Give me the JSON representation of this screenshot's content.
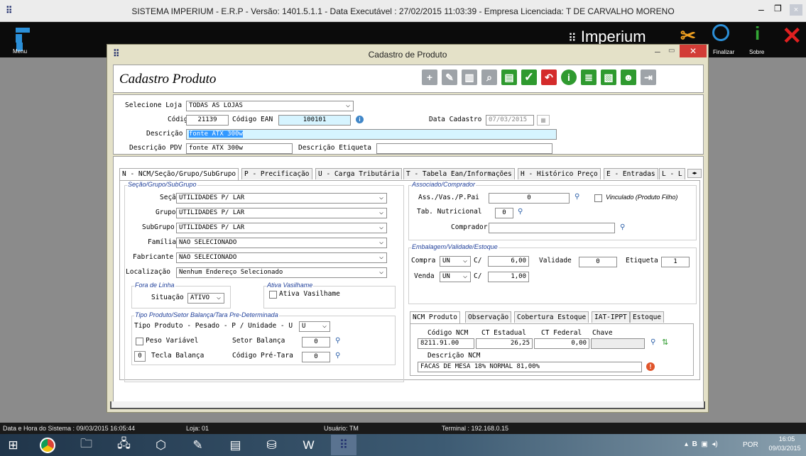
{
  "titlebar": {
    "title": "SISTEMA IMPERIUM - E.R.P - Versão: 1401.5.1.1 - Data Executável : 27/02/2015 11:03:39 - Empresa Licenciada: T DE CARVALHO MORENO"
  },
  "topband": {
    "menu_label": "Menu",
    "brand": "Imperium",
    "finalizar_label": "Finalizar",
    "sobre_label": "Sobre"
  },
  "window": {
    "title": "Cadastro de Produto",
    "heading": "Cadastro Produto"
  },
  "toolbar": {
    "icons": [
      "plus-icon",
      "edit-icon",
      "delete-icon",
      "search-icon",
      "document-icon",
      "confirm-icon",
      "undo-icon",
      "info-icon",
      "report-search-icon",
      "report-icon",
      "user-icon",
      "exit-icon"
    ],
    "colors": {
      "confirm": "#2f9a2f",
      "undo": "#d42b2b",
      "neutral": "#9ea3a8"
    }
  },
  "header": {
    "loja_label": "Selecione Loja",
    "loja_value": "TODAS AS LOJAS",
    "codigo_label": "Código",
    "codigo_value": "21139",
    "ean_label": "Código EAN",
    "ean_value": "100101",
    "data_label": "Data Cadastro",
    "data_value": "07/03/2015",
    "descricao_label": "Descrição",
    "descricao_value": "fonte ATX 300w",
    "pdv_label": "Descrição PDV",
    "pdv_value": "fonte ATX 300w",
    "etiqueta_label": "Descrição Etiqueta",
    "etiqueta_value": ""
  },
  "tabs": [
    "N - NCM/Seção/Grupo/SubGrupo",
    "P - Precificação",
    "U - Carga Tributária",
    "T - Tabela Ean/Informações",
    "H - Histórico Preço",
    "E - Entradas",
    "L - L"
  ],
  "secao_grupo": {
    "legend": "Seção/Grupo/SubGrupo",
    "fields": [
      {
        "label": "Seção",
        "value": "UTILIDADES P/ LAR"
      },
      {
        "label": "Grupo",
        "value": "UTILIDADES P/ LAR"
      },
      {
        "label": "SubGrupo",
        "value": "UTILIDADES P/ LAR"
      },
      {
        "label": "Família",
        "value": "NAO SELECIONADO"
      },
      {
        "label": "Fabricante",
        "value": "NAO SELECIONADO"
      },
      {
        "label": "Localização",
        "value": "Nenhum Endereço Selecionado"
      }
    ]
  },
  "fora_linha": {
    "legend": "Fora de Linha",
    "situacao_label": "Situação",
    "situacao_value": "ATIVO"
  },
  "vasilhame": {
    "legend": "Ativa Vasilhame",
    "checkbox_label": "Ativa Vasilhame"
  },
  "tipo_produto": {
    "legend": "Tipo Produto/Setor Balança/Tara Pre-Determinada",
    "tipo_label": "Tipo Produto - Pesado - P / Unidade - U",
    "tipo_value": "U",
    "peso_label": "Peso Variável",
    "setor_label": "Setor Balança",
    "setor_value": "0",
    "tecla_value": "0",
    "tecla_label": "Tecla Balança",
    "tara_label": "Código Pré-Tara",
    "tara_value": "0"
  },
  "associado": {
    "legend": "Associado/Comprador",
    "ass_label": "Ass./Vas./P.Pai",
    "ass_value": "0",
    "vinculado_label": "Vinculado (Produto Filho)",
    "tab_label": "Tab. Nutricional",
    "tab_value": "0",
    "comprador_label": "Comprador",
    "comprador_value": ""
  },
  "embalagem": {
    "legend": "Embalagem/Validade/Estoque",
    "compra_label": "Compra",
    "compra_unit": "UN",
    "c1": "C/",
    "compra_qty": "6,00",
    "validade_label": "Validade",
    "validade_value": "0",
    "etiqueta_label": "Etiqueta",
    "etiqueta_value": "1",
    "venda_label": "Venda",
    "venda_unit": "UN",
    "c2": "C/",
    "venda_qty": "1,00"
  },
  "ncm": {
    "tabs": [
      "NCM Produto",
      "Observação",
      "Cobertura Estoque",
      "IAT-IPPT",
      "Estoque"
    ],
    "codigo_label": "Código NCM",
    "codigo_value": "8211.91.00",
    "estadual_label": "CT Estadual",
    "estadual_value": "26,25",
    "federal_label": "CT Federal",
    "federal_value": "0,00",
    "chave_label": "Chave",
    "chave_value": "",
    "desc_label": "Descrição NCM",
    "desc_value": "FACAS DE MESA 18% NORMAL 81,00%"
  },
  "statusbar": {
    "datetime": "Data e Hora do Sistema : 09/03/2015 16:05:44",
    "loja": "Loja: 01",
    "usuario": "Usuário: TM",
    "terminal": "Terminal : 192.168.0.15"
  },
  "tray": {
    "lang": "POR",
    "time": "16:05",
    "date": "09/03/2015"
  }
}
